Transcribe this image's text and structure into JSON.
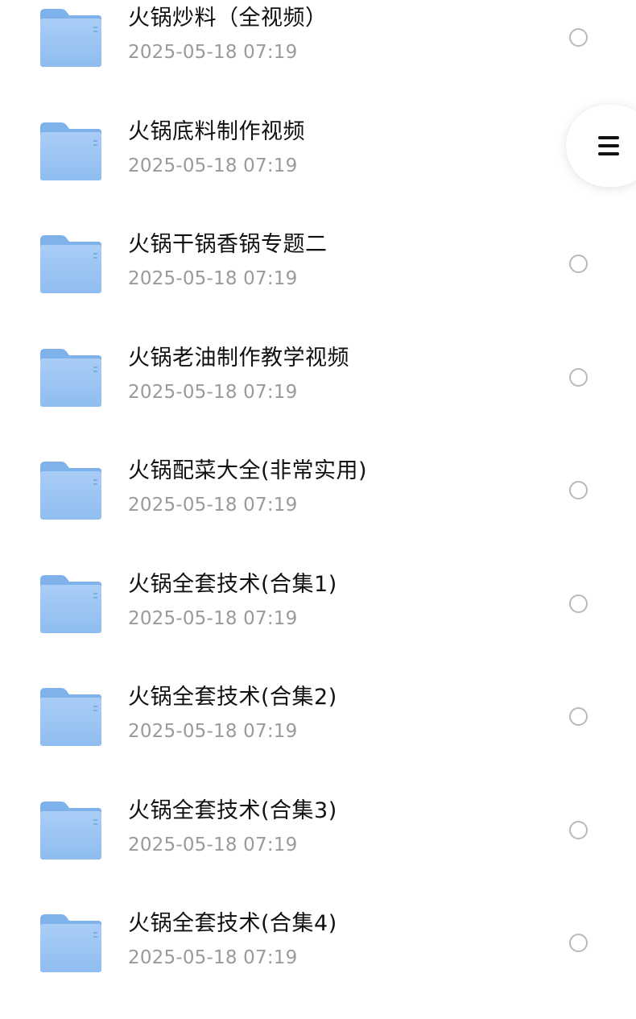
{
  "files": [
    {
      "name": "火锅炒料（全视频）",
      "date": "2025-05-18 07:19",
      "icon": "folder-icon",
      "selected": false
    },
    {
      "name": "火锅底料制作视频",
      "date": "2025-05-18 07:19",
      "icon": "folder-icon",
      "selected": false
    },
    {
      "name": "火锅干锅香锅专题二",
      "date": "2025-05-18 07:19",
      "icon": "folder-icon",
      "selected": false
    },
    {
      "name": "火锅老油制作教学视频",
      "date": "2025-05-18 07:19",
      "icon": "folder-icon",
      "selected": false
    },
    {
      "name": "火锅配菜大全(非常实用)",
      "date": "2025-05-18 07:19",
      "icon": "folder-icon",
      "selected": false
    },
    {
      "name": "火锅全套技术(合集1)",
      "date": "2025-05-18 07:19",
      "icon": "folder-icon",
      "selected": false
    },
    {
      "name": "火锅全套技术(合集2)",
      "date": "2025-05-18 07:19",
      "icon": "folder-icon",
      "selected": false
    },
    {
      "name": "火锅全套技术(合集3)",
      "date": "2025-05-18 07:19",
      "icon": "folder-icon",
      "selected": false
    },
    {
      "name": "火锅全套技术(合集4)",
      "date": "2025-05-18 07:19",
      "icon": "folder-icon",
      "selected": false
    }
  ],
  "floating_menu": {
    "icon": "menu-icon"
  },
  "colors": {
    "folder_back": "#7fb1ea",
    "folder_front_top": "#a9cdf6",
    "folder_front_bottom": "#8fbdf0",
    "title_text": "#111111",
    "date_text": "#9a9a9a",
    "radio_border": "#b9b9b9"
  }
}
